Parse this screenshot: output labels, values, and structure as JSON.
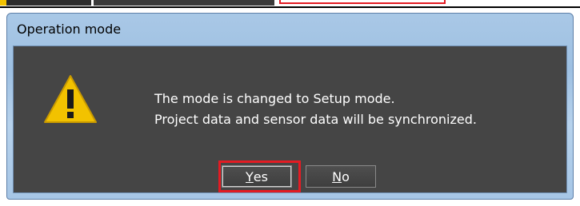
{
  "dialog": {
    "title": "Operation mode",
    "icon": "warning-triangle-icon",
    "message_lines": [
      "The mode is changed to Setup mode.",
      "Project data and sensor data will be synchronized."
    ],
    "buttons": {
      "yes": {
        "mnemonic": "Y",
        "rest": "es"
      },
      "no": {
        "mnemonic": "N",
        "rest": "o"
      }
    }
  },
  "colors": {
    "client_bg": "#454545",
    "warning_fill": "#f2c200",
    "highlight": "#e31b23",
    "titlebar": "#a9c8e6"
  }
}
